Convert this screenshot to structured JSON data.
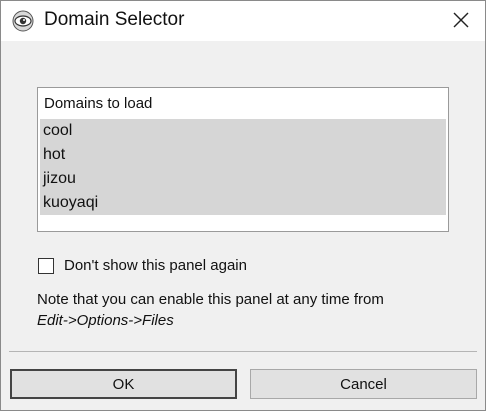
{
  "window": {
    "title": "Domain Selector",
    "icon": "eye-icon"
  },
  "domains_panel": {
    "header": "Domains to load",
    "items": [
      "cool",
      "hot",
      "jizou",
      "kuoyaqi"
    ]
  },
  "options": {
    "dont_show_label": "Don't show this panel again",
    "dont_show_checked": false
  },
  "note": {
    "line1": "Note that you can enable this panel at any time from",
    "line2": "Edit->Options->Files"
  },
  "buttons": {
    "ok": "OK",
    "cancel": "Cancel"
  }
}
